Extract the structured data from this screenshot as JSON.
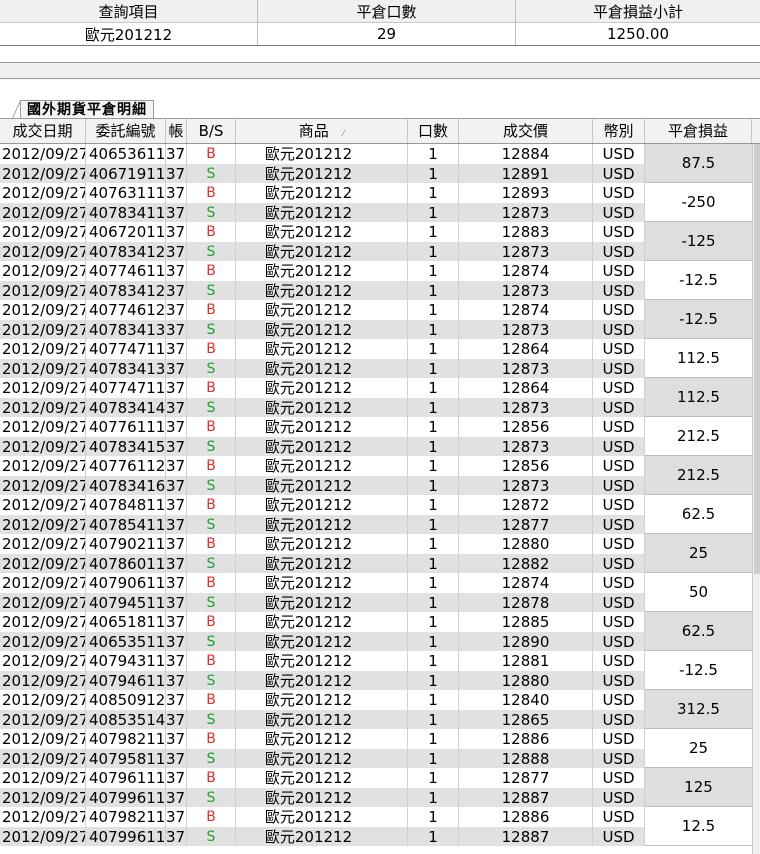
{
  "summary": {
    "headers": [
      "查詢項目",
      "平倉口數",
      "平倉損益小計"
    ],
    "row": [
      "歐元201212",
      "29",
      "1250.00"
    ]
  },
  "tab_label": "國外期貨平倉明細",
  "grid": {
    "columns": [
      "成交日期",
      "委託編號",
      "帳",
      "B/S",
      "商品",
      "口數",
      "成交價",
      "幣別",
      "平倉損益"
    ],
    "sorted_column_marker": "⁄",
    "account_fragment": "37:",
    "rows": [
      {
        "date": "2012/09/27",
        "order": "40653611",
        "bs": "B",
        "product": "歐元201212",
        "qty": "1",
        "price": "12884",
        "ccy": "USD"
      },
      {
        "date": "2012/09/27",
        "order": "40671911",
        "bs": "S",
        "product": "歐元201212",
        "qty": "1",
        "price": "12891",
        "ccy": "USD"
      },
      {
        "date": "2012/09/27",
        "order": "40763111",
        "bs": "B",
        "product": "歐元201212",
        "qty": "1",
        "price": "12893",
        "ccy": "USD"
      },
      {
        "date": "2012/09/27",
        "order": "40783411",
        "bs": "S",
        "product": "歐元201212",
        "qty": "1",
        "price": "12873",
        "ccy": "USD"
      },
      {
        "date": "2012/09/27",
        "order": "40672011",
        "bs": "B",
        "product": "歐元201212",
        "qty": "1",
        "price": "12883",
        "ccy": "USD"
      },
      {
        "date": "2012/09/27",
        "order": "40783412",
        "bs": "S",
        "product": "歐元201212",
        "qty": "1",
        "price": "12873",
        "ccy": "USD"
      },
      {
        "date": "2012/09/27",
        "order": "40774611",
        "bs": "B",
        "product": "歐元201212",
        "qty": "1",
        "price": "12874",
        "ccy": "USD"
      },
      {
        "date": "2012/09/27",
        "order": "40783412",
        "bs": "S",
        "product": "歐元201212",
        "qty": "1",
        "price": "12873",
        "ccy": "USD"
      },
      {
        "date": "2012/09/27",
        "order": "40774612",
        "bs": "B",
        "product": "歐元201212",
        "qty": "1",
        "price": "12874",
        "ccy": "USD"
      },
      {
        "date": "2012/09/27",
        "order": "40783413",
        "bs": "S",
        "product": "歐元201212",
        "qty": "1",
        "price": "12873",
        "ccy": "USD"
      },
      {
        "date": "2012/09/27",
        "order": "40774711",
        "bs": "B",
        "product": "歐元201212",
        "qty": "1",
        "price": "12864",
        "ccy": "USD"
      },
      {
        "date": "2012/09/27",
        "order": "40783413",
        "bs": "S",
        "product": "歐元201212",
        "qty": "1",
        "price": "12873",
        "ccy": "USD"
      },
      {
        "date": "2012/09/27",
        "order": "40774711",
        "bs": "B",
        "product": "歐元201212",
        "qty": "1",
        "price": "12864",
        "ccy": "USD"
      },
      {
        "date": "2012/09/27",
        "order": "40783414",
        "bs": "S",
        "product": "歐元201212",
        "qty": "1",
        "price": "12873",
        "ccy": "USD"
      },
      {
        "date": "2012/09/27",
        "order": "40776111",
        "bs": "B",
        "product": "歐元201212",
        "qty": "1",
        "price": "12856",
        "ccy": "USD"
      },
      {
        "date": "2012/09/27",
        "order": "40783415",
        "bs": "S",
        "product": "歐元201212",
        "qty": "1",
        "price": "12873",
        "ccy": "USD"
      },
      {
        "date": "2012/09/27",
        "order": "40776112",
        "bs": "B",
        "product": "歐元201212",
        "qty": "1",
        "price": "12856",
        "ccy": "USD"
      },
      {
        "date": "2012/09/27",
        "order": "40783416",
        "bs": "S",
        "product": "歐元201212",
        "qty": "1",
        "price": "12873",
        "ccy": "USD"
      },
      {
        "date": "2012/09/27",
        "order": "40784811",
        "bs": "B",
        "product": "歐元201212",
        "qty": "1",
        "price": "12872",
        "ccy": "USD"
      },
      {
        "date": "2012/09/27",
        "order": "40785411",
        "bs": "S",
        "product": "歐元201212",
        "qty": "1",
        "price": "12877",
        "ccy": "USD"
      },
      {
        "date": "2012/09/27",
        "order": "40790211",
        "bs": "B",
        "product": "歐元201212",
        "qty": "1",
        "price": "12880",
        "ccy": "USD"
      },
      {
        "date": "2012/09/27",
        "order": "40786011",
        "bs": "S",
        "product": "歐元201212",
        "qty": "1",
        "price": "12882",
        "ccy": "USD"
      },
      {
        "date": "2012/09/27",
        "order": "40790611",
        "bs": "B",
        "product": "歐元201212",
        "qty": "1",
        "price": "12874",
        "ccy": "USD"
      },
      {
        "date": "2012/09/27",
        "order": "40794511",
        "bs": "S",
        "product": "歐元201212",
        "qty": "1",
        "price": "12878",
        "ccy": "USD"
      },
      {
        "date": "2012/09/27",
        "order": "40651811",
        "bs": "B",
        "product": "歐元201212",
        "qty": "1",
        "price": "12885",
        "ccy": "USD"
      },
      {
        "date": "2012/09/27",
        "order": "40653511",
        "bs": "S",
        "product": "歐元201212",
        "qty": "1",
        "price": "12890",
        "ccy": "USD"
      },
      {
        "date": "2012/09/27",
        "order": "40794311",
        "bs": "B",
        "product": "歐元201212",
        "qty": "1",
        "price": "12881",
        "ccy": "USD"
      },
      {
        "date": "2012/09/27",
        "order": "40794611",
        "bs": "S",
        "product": "歐元201212",
        "qty": "1",
        "price": "12880",
        "ccy": "USD"
      },
      {
        "date": "2012/09/27",
        "order": "40850912",
        "bs": "B",
        "product": "歐元201212",
        "qty": "1",
        "price": "12840",
        "ccy": "USD"
      },
      {
        "date": "2012/09/27",
        "order": "40853514",
        "bs": "S",
        "product": "歐元201212",
        "qty": "1",
        "price": "12865",
        "ccy": "USD"
      },
      {
        "date": "2012/09/27",
        "order": "40798211",
        "bs": "B",
        "product": "歐元201212",
        "qty": "1",
        "price": "12886",
        "ccy": "USD"
      },
      {
        "date": "2012/09/27",
        "order": "40795811",
        "bs": "S",
        "product": "歐元201212",
        "qty": "1",
        "price": "12888",
        "ccy": "USD"
      },
      {
        "date": "2012/09/27",
        "order": "40796111",
        "bs": "B",
        "product": "歐元201212",
        "qty": "1",
        "price": "12877",
        "ccy": "USD"
      },
      {
        "date": "2012/09/27",
        "order": "40799611",
        "bs": "S",
        "product": "歐元201212",
        "qty": "1",
        "price": "12887",
        "ccy": "USD"
      },
      {
        "date": "2012/09/27",
        "order": "40798211",
        "bs": "B",
        "product": "歐元201212",
        "qty": "1",
        "price": "12886",
        "ccy": "USD"
      },
      {
        "date": "2012/09/27",
        "order": "40799611",
        "bs": "S",
        "product": "歐元201212",
        "qty": "1",
        "price": "12887",
        "ccy": "USD"
      }
    ],
    "pnl": [
      "87.5",
      "-250",
      "-125",
      "-12.5",
      "-12.5",
      "112.5",
      "112.5",
      "212.5",
      "212.5",
      "62.5",
      "25",
      "50",
      "62.5",
      "-12.5",
      "312.5",
      "25",
      "125",
      "12.5"
    ]
  },
  "colors": {
    "buy": "#e03030",
    "sell": "#1ea030",
    "alt_row": "#e1e1e1"
  }
}
